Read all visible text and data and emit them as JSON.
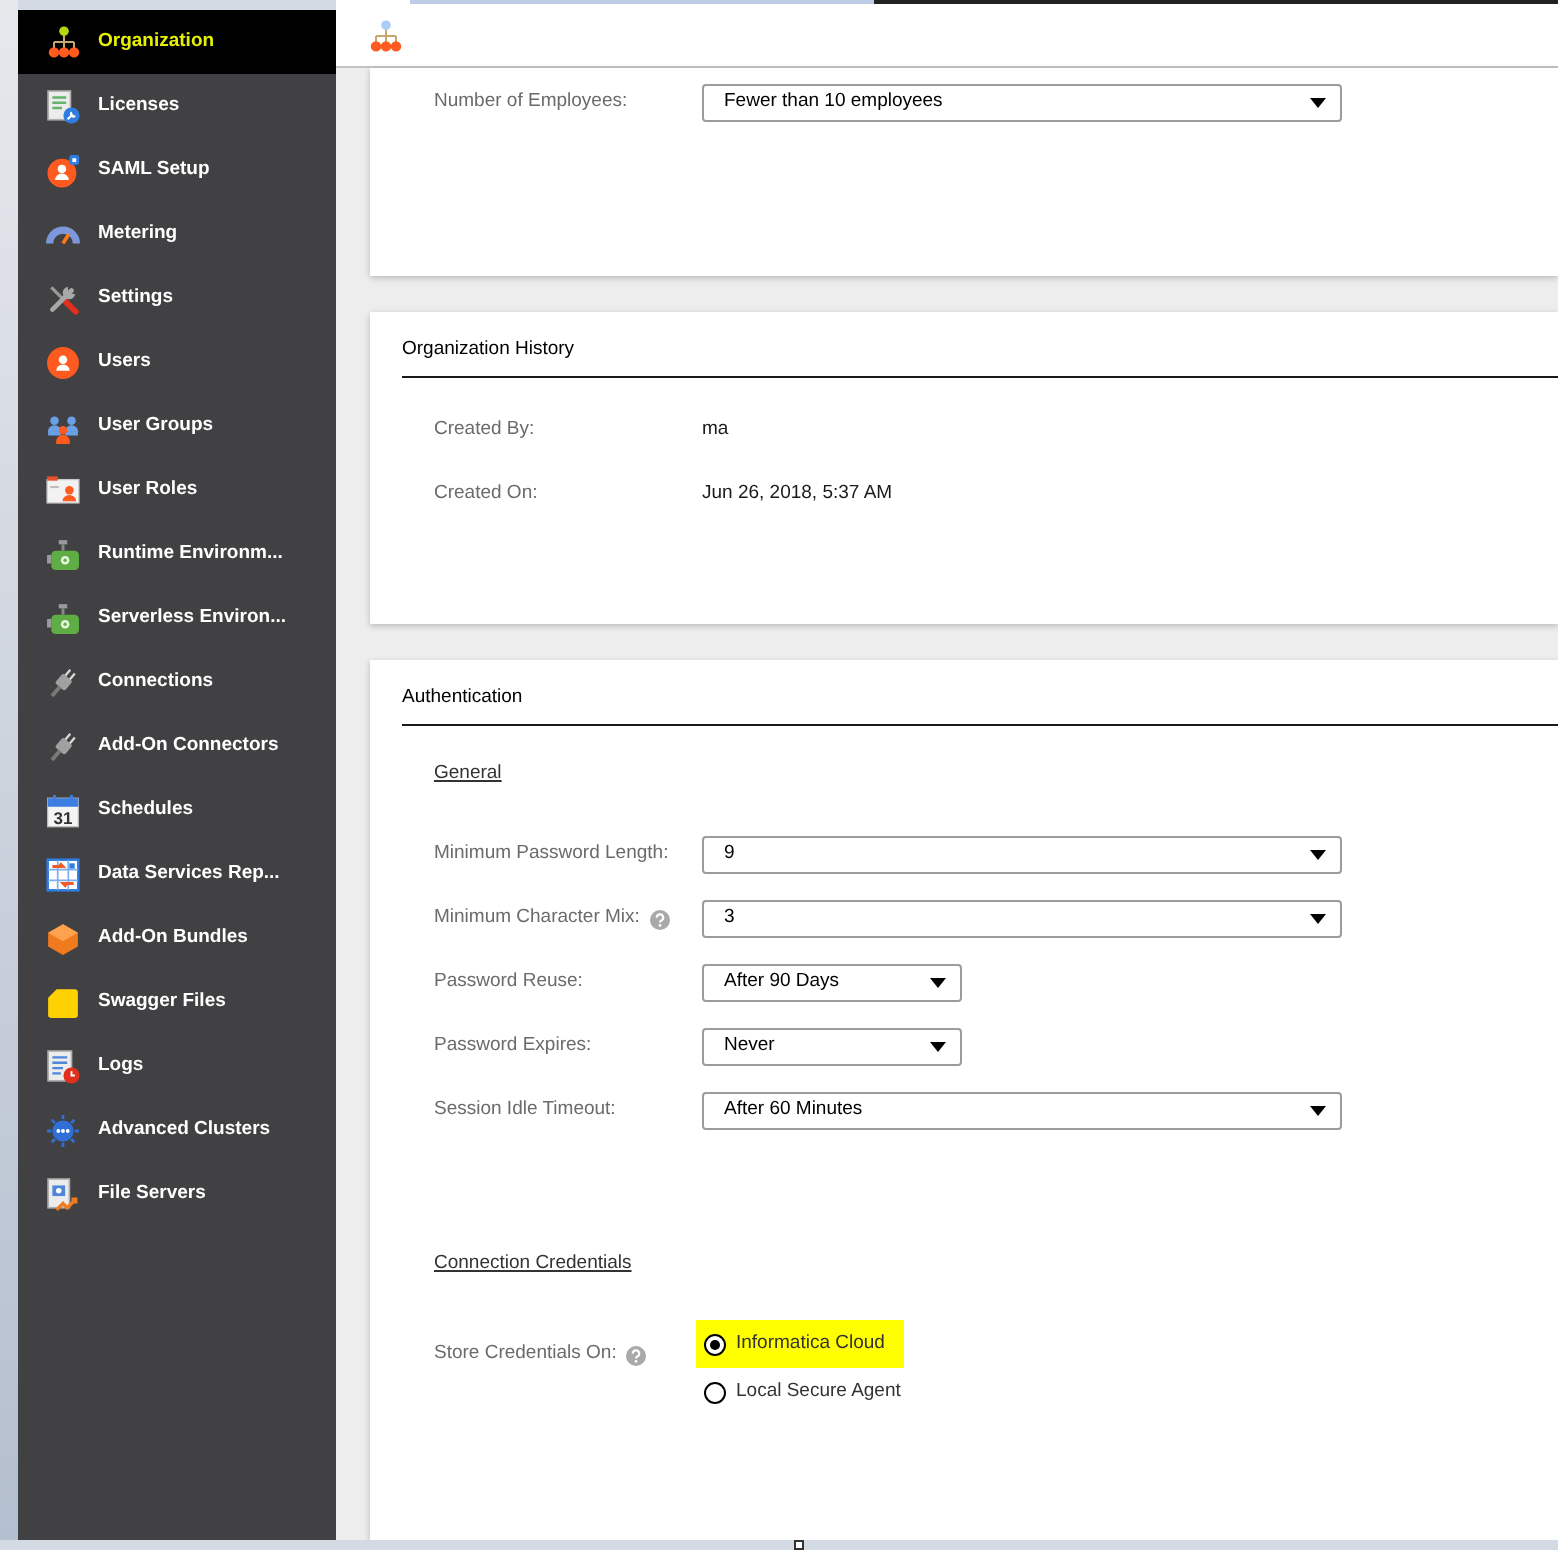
{
  "sidebar": {
    "items": [
      {
        "label": "Organization",
        "selected": true
      },
      {
        "label": "Licenses",
        "selected": false
      },
      {
        "label": "SAML Setup",
        "selected": false
      },
      {
        "label": "Metering",
        "selected": false
      },
      {
        "label": "Settings",
        "selected": false
      },
      {
        "label": "Users",
        "selected": false
      },
      {
        "label": "User Groups",
        "selected": false
      },
      {
        "label": "User Roles",
        "selected": false
      },
      {
        "label": "Runtime Environm...",
        "selected": false
      },
      {
        "label": "Serverless Environ...",
        "selected": false
      },
      {
        "label": "Connections",
        "selected": false
      },
      {
        "label": "Add-On Connectors",
        "selected": false
      },
      {
        "label": "Schedules",
        "selected": false,
        "icon_text": "31"
      },
      {
        "label": "Data Services Rep...",
        "selected": false
      },
      {
        "label": "Add-On Bundles",
        "selected": false
      },
      {
        "label": "Swagger Files",
        "selected": false
      },
      {
        "label": "Logs",
        "selected": false
      },
      {
        "label": "Advanced Clusters",
        "selected": false
      },
      {
        "label": "File Servers",
        "selected": false
      }
    ]
  },
  "sections": [
    {
      "groups": [
        {
          "fields": [
            {
              "kind": "select",
              "label": "Number of Employees:",
              "help": false,
              "wide": true,
              "value": "Fewer than 10 employees"
            }
          ]
        }
      ]
    },
    {
      "title": "Organization History",
      "groups": [
        {
          "fields": [
            {
              "kind": "text",
              "label": "Created By:",
              "help": false,
              "value": "ma"
            },
            {
              "kind": "text",
              "label": "Created On:",
              "help": false,
              "value": "Jun 26, 2018, 5:37 AM"
            }
          ]
        }
      ]
    },
    {
      "title": "Authentication",
      "groups": [
        {
          "heading": "General",
          "fields": [
            {
              "kind": "select",
              "label": "Minimum Password Length:",
              "help": false,
              "wide": true,
              "value": "9"
            },
            {
              "kind": "select",
              "label": "Minimum Character Mix:",
              "help": true,
              "wide": true,
              "value": "3"
            },
            {
              "kind": "select",
              "label": "Password Reuse:",
              "help": false,
              "wide": false,
              "value": "After 90 Days"
            },
            {
              "kind": "select",
              "label": "Password Expires:",
              "help": false,
              "wide": false,
              "value": "Never"
            },
            {
              "kind": "select",
              "label": "Session Idle Timeout:",
              "help": false,
              "wide": true,
              "value": "After 60 Minutes"
            }
          ]
        },
        {
          "heading": "Connection Credentials",
          "fields": [
            {
              "kind": "radio",
              "label": "Store Credentials On:",
              "help": true,
              "options": [
                {
                  "label": "Informatica Cloud",
                  "selected": true,
                  "highlighted": true
                },
                {
                  "label": "Local Secure Agent",
                  "selected": false,
                  "highlighted": false
                }
              ]
            }
          ]
        }
      ]
    }
  ]
}
